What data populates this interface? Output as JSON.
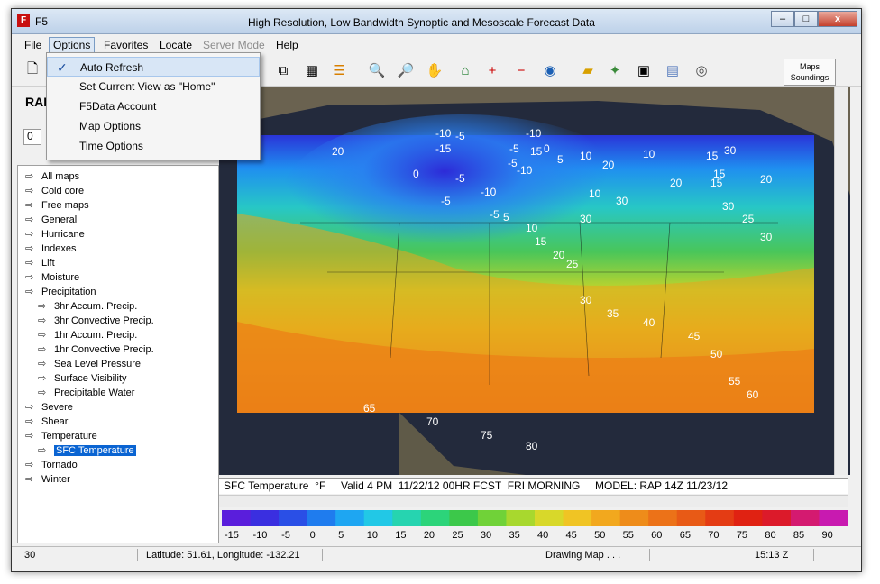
{
  "app_title": "F5",
  "window_title": "High Resolution, Low Bandwidth Synoptic and Mesoscale Forecast Data",
  "menu": [
    "File",
    "Options",
    "Favorites",
    "Locate",
    "Server Mode",
    "Help"
  ],
  "options_menu": [
    "Auto Refresh",
    "Set Current View as \"Home\"",
    "F5Data Account",
    "Map Options",
    "Time Options"
  ],
  "toolbar": {
    "maps_label": "Maps",
    "soundings_label": "Soundings"
  },
  "left_panel": {
    "title": "RAP",
    "field_value": "0"
  },
  "tree": [
    {
      "label": "All maps",
      "level": 0
    },
    {
      "label": "Cold core",
      "level": 0
    },
    {
      "label": "Free maps",
      "level": 0
    },
    {
      "label": "General",
      "level": 0
    },
    {
      "label": "Hurricane",
      "level": 0
    },
    {
      "label": "Indexes",
      "level": 0
    },
    {
      "label": "Lift",
      "level": 0
    },
    {
      "label": "Moisture",
      "level": 0
    },
    {
      "label": "Precipitation",
      "level": 0
    },
    {
      "label": "3hr Accum. Precip.",
      "level": 1
    },
    {
      "label": "3hr Convective Precip.",
      "level": 1
    },
    {
      "label": "1hr Accum. Precip.",
      "level": 1
    },
    {
      "label": "1hr Convective Precip.",
      "level": 1
    },
    {
      "label": "Sea Level Pressure",
      "level": 1
    },
    {
      "label": "Surface Visibility",
      "level": 1
    },
    {
      "label": "Precipitable Water",
      "level": 1
    },
    {
      "label": "Severe",
      "level": 0
    },
    {
      "label": "Shear",
      "level": 0
    },
    {
      "label": "Temperature",
      "level": 0
    },
    {
      "label": "SFC Temperature",
      "level": 1,
      "selected": true
    },
    {
      "label": "Tornado",
      "level": 0
    },
    {
      "label": "Winter",
      "level": 0
    }
  ],
  "map_info": "SFC Temperature  °F     Valid 4 PM  11/22/12 00HR FCST  FRI MORNING     MODEL: RAP 14Z 11/23/12",
  "colorbar_ticks": [
    "-15",
    "-10",
    "-5",
    "0",
    "5",
    "10",
    "15",
    "20",
    "25",
    "30",
    "35",
    "40",
    "45",
    "50",
    "55",
    "60",
    "65",
    "70",
    "75",
    "80",
    "85",
    "90"
  ],
  "status": {
    "value": "30",
    "coords": "Latitude: 51.61, Longitude: -132.21",
    "message": "Drawing Map . . .",
    "time": "15:13 Z"
  },
  "map_labels": [
    "-10",
    "-5",
    "-10",
    "-15",
    "-5",
    "0",
    "5",
    "10",
    "-5",
    "-10",
    "15",
    "10",
    "20",
    "20",
    "10",
    "30",
    "15",
    "15",
    "20",
    "30",
    "15",
    "30",
    "30",
    "25",
    "30",
    "20",
    "0",
    "-5",
    "-5",
    "-10",
    "-5",
    "5",
    "10",
    "15",
    "20",
    "25",
    "30",
    "35",
    "40",
    "45",
    "50",
    "55",
    "60",
    "65",
    "70",
    "75",
    "80"
  ]
}
